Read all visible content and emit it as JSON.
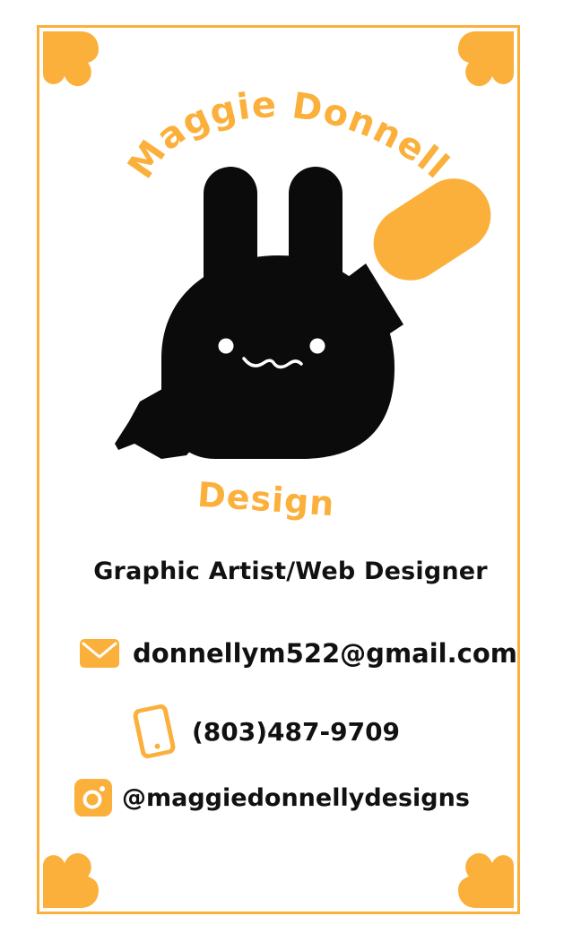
{
  "brand": {
    "name": "Maggie Donnelly",
    "subtitle": "Design"
  },
  "tagline": "Graphic Artist/Web Designer",
  "contacts": {
    "email": "donnellym522@gmail.com",
    "phone": "(803)487-9709",
    "instagram": "@maggiedonnellydesigns"
  },
  "icons": {
    "email": "envelope-icon",
    "phone": "phone-icon",
    "instagram": "instagram-icon",
    "corner": "heart-icon"
  },
  "colors": {
    "accent": "#fbb03b",
    "ink": "#111111",
    "background": "#ffffff"
  }
}
